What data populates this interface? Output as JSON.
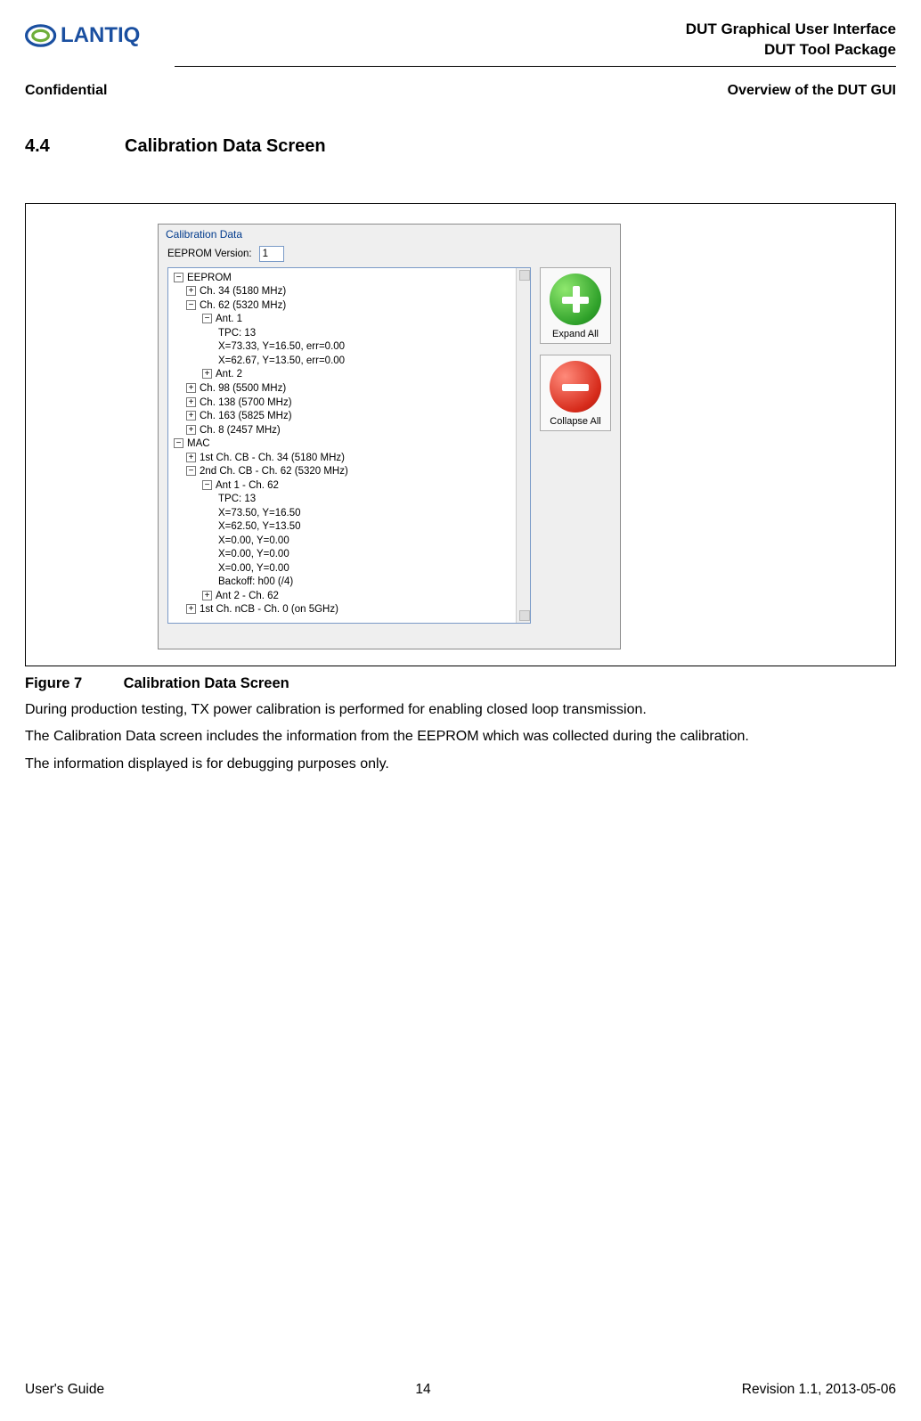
{
  "header": {
    "doc_title_line1": "DUT Graphical User Interface",
    "doc_title_line2": "DUT Tool Package",
    "confidential": "Confidential",
    "overview": "Overview of the DUT GUI"
  },
  "section": {
    "number": "4.4",
    "title": "Calibration Data Screen"
  },
  "app": {
    "panel_title": "Calibration Data",
    "eeprom_label": "EEPROM Version:",
    "eeprom_value": "1",
    "buttons": {
      "expand": "Expand All",
      "collapse": "Collapse All"
    },
    "tree": {
      "eeprom": "EEPROM",
      "ch34": "Ch. 34 (5180 MHz)",
      "ch62": "Ch. 62 (5320 MHz)",
      "ant1": "Ant. 1",
      "tpc13": "TPC: 13",
      "row1": "X=73.33, Y=16.50, err=0.00",
      "row2": "X=62.67, Y=13.50, err=0.00",
      "ant2": "Ant. 2",
      "ch98": "Ch. 98 (5500 MHz)",
      "ch138": "Ch. 138 (5700 MHz)",
      "ch163": "Ch. 163 (5825 MHz)",
      "ch8": "Ch. 8 (2457 MHz)",
      "mac": "MAC",
      "mac1": "1st Ch. CB - Ch. 34 (5180 MHz)",
      "mac2": "2nd Ch. CB - Ch. 62 (5320 MHz)",
      "mac2a": "Ant 1 - Ch. 62",
      "m_tpc": "TPC: 13",
      "m_r1": "X=73.50, Y=16.50",
      "m_r2": "X=62.50, Y=13.50",
      "m_r3": "X=0.00, Y=0.00",
      "m_r4": "X=0.00, Y=0.00",
      "m_r5": "X=0.00, Y=0.00",
      "m_r6": "Backoff: h00 (/4)",
      "mac2b": "Ant 2 - Ch. 62",
      "mac3": "1st Ch. nCB - Ch. 0 (on 5GHz)"
    }
  },
  "figure": {
    "label": "Figure 7",
    "caption": "Calibration Data Screen"
  },
  "paragraphs": {
    "p1": "During production testing, TX power calibration is performed for enabling closed loop transmission.",
    "p2": "The Calibration Data screen includes the information from the EEPROM which was collected during the calibration.",
    "p3": "The information displayed is for debugging purposes only."
  },
  "footer": {
    "left": "User's Guide",
    "center": "14",
    "right": "Revision 1.1, 2013-05-06"
  }
}
